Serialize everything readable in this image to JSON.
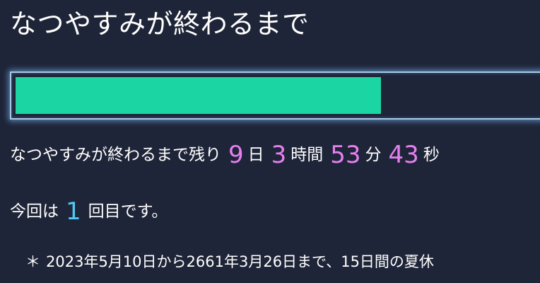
{
  "title": "なつやすみが終わるまで",
  "colors": {
    "background": "#1f2538",
    "progress_fill": "#1bd6a2",
    "progress_border": "#a8c8e8",
    "countdown_number": "#e680f0",
    "count_number": "#4fc8f5"
  },
  "progress": {
    "percent_complete": 68
  },
  "remaining": {
    "prefix": "なつやすみが終わるまで残り",
    "days": "9",
    "days_unit": "日",
    "hours": "3",
    "hours_unit": "時間",
    "minutes": "53",
    "minutes_unit": "分",
    "seconds": "43",
    "seconds_unit": "秒"
  },
  "count": {
    "prefix": "今回は",
    "number": "1",
    "suffix": "回目です。"
  },
  "note": {
    "bullet": "＊",
    "text": "2023年5月10日から2661年3月26日まで、15日間の夏休"
  }
}
